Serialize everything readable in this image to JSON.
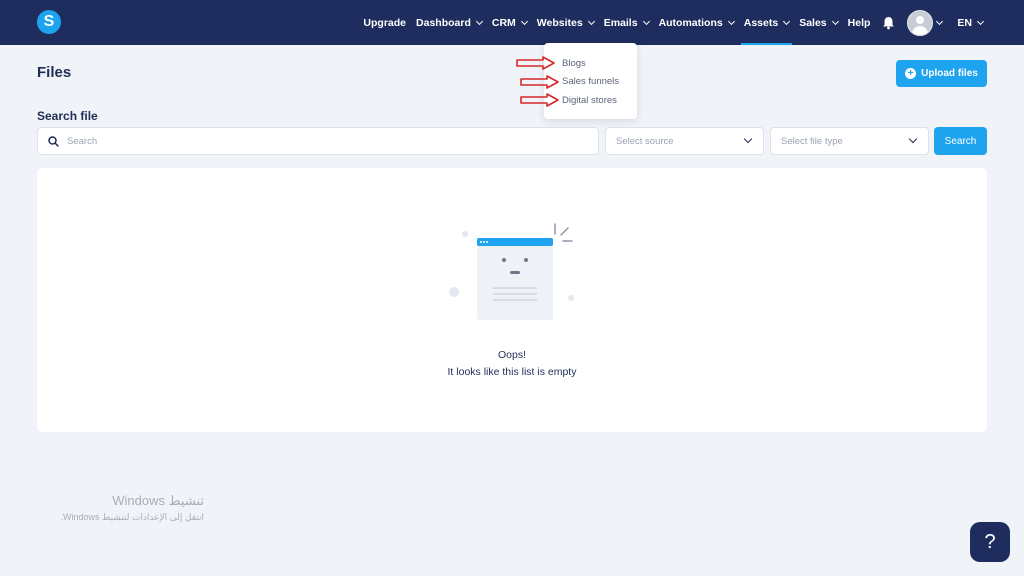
{
  "brand": {
    "logo_letter": "S",
    "color": "#1ea3ee"
  },
  "nav": {
    "items": [
      {
        "label": "Upgrade"
      },
      {
        "label": "Dashboard"
      },
      {
        "label": "CRM"
      },
      {
        "label": "Websites"
      },
      {
        "label": "Emails"
      },
      {
        "label": "Automations"
      },
      {
        "label": "Assets"
      },
      {
        "label": "Sales"
      },
      {
        "label": "Help"
      }
    ],
    "active": "Assets",
    "language": "EN",
    "icons": [
      "bell-icon",
      "avatar"
    ]
  },
  "websites_menu": {
    "items": [
      "Blogs",
      "Sales funnels",
      "Digital stores"
    ]
  },
  "page": {
    "title": "Files",
    "upload_label": "Upload files"
  },
  "search": {
    "label": "Search file",
    "placeholder": "Search",
    "source_placeholder": "Select source",
    "type_placeholder": "Select file type",
    "button_label": "Search"
  },
  "empty_state": {
    "title": "Oops!",
    "subtitle": "It looks like this list is empty"
  },
  "watermark": {
    "line1": "تنشيط Windows",
    "line2": "انتقل إلى الإعدادات لتنشيط Windows."
  },
  "help": {
    "label": "?"
  },
  "colors": {
    "topbar": "#1e2d5e",
    "accent": "#1ea3ee",
    "background": "#f0f3f8",
    "annotation_arrow": "#d62828"
  }
}
